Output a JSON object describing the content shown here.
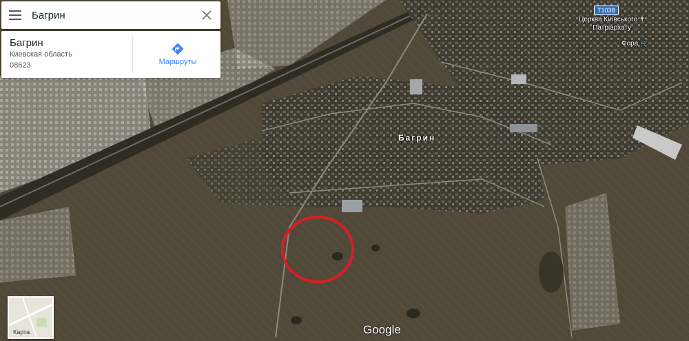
{
  "search": {
    "value": "Багрин"
  },
  "place": {
    "name": "Багрин",
    "region": "Киевская область",
    "postal_code": "08623",
    "directions_label": "Маршруты"
  },
  "map": {
    "town_label": "Багрин",
    "church_label": [
      "Церква Київського",
      "Патріархату"
    ],
    "shop_label": "Фора",
    "road_shield": "T1038",
    "attribution": "Google",
    "minimap_label": "Карта",
    "highlight_color": "#d81f26"
  },
  "icons": [
    "menu-icon",
    "close-icon",
    "directions-icon",
    "church-icon",
    "shop-icon"
  ]
}
